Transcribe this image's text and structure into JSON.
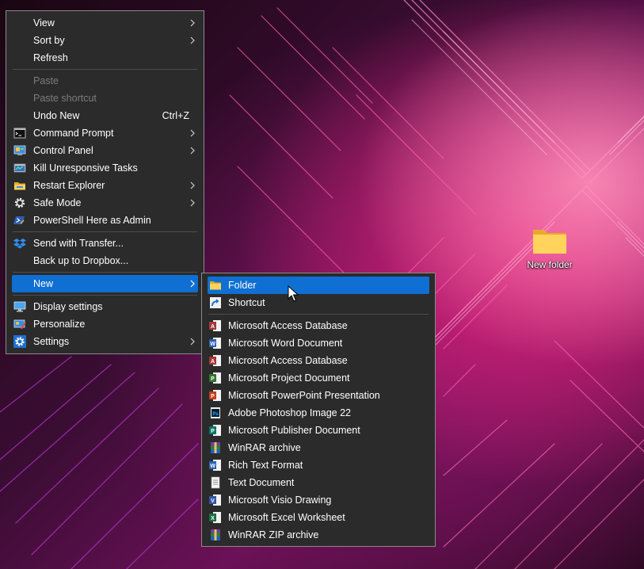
{
  "desktop": {
    "folder_label": "New folder"
  },
  "main_menu": {
    "items": [
      {
        "label": "View",
        "has_submenu": true
      },
      {
        "label": "Sort by",
        "has_submenu": true
      },
      {
        "label": "Refresh"
      },
      {
        "label": "Paste",
        "disabled": true
      },
      {
        "label": "Paste shortcut",
        "disabled": true
      },
      {
        "label": "Undo New",
        "shortcut": "Ctrl+Z"
      },
      {
        "label": "Command Prompt",
        "icon": "command-prompt-icon",
        "has_submenu": true
      },
      {
        "label": "Control Panel",
        "icon": "control-panel-icon",
        "has_submenu": true
      },
      {
        "label": "Kill Unresponsive Tasks",
        "icon": "kill-tasks-icon"
      },
      {
        "label": "Restart Explorer",
        "icon": "explorer-folder-icon",
        "has_submenu": true
      },
      {
        "label": "Safe Mode",
        "icon": "gear-icon",
        "has_submenu": true
      },
      {
        "label": "PowerShell Here as Admin",
        "icon": "powershell-icon"
      },
      {
        "label": "Send with Transfer...",
        "icon": "dropbox-icon"
      },
      {
        "label": "Back up to Dropbox..."
      },
      {
        "label": "New",
        "has_submenu": true,
        "highlighted": true
      },
      {
        "label": "Display settings",
        "icon": "display-icon"
      },
      {
        "label": "Personalize",
        "icon": "personalize-icon"
      },
      {
        "label": "Settings",
        "icon": "settings-gear-icon",
        "has_submenu": true
      }
    ]
  },
  "sub_menu": {
    "items": [
      {
        "label": "Folder",
        "icon": "folder-icon",
        "highlighted": true
      },
      {
        "label": "Shortcut",
        "icon": "shortcut-icon"
      },
      {
        "label": "Microsoft Access Database",
        "icon": "access-icon"
      },
      {
        "label": "Microsoft Word Document",
        "icon": "word-icon"
      },
      {
        "label": "Microsoft Access Database",
        "icon": "access-icon"
      },
      {
        "label": "Microsoft Project Document",
        "icon": "project-icon"
      },
      {
        "label": "Microsoft PowerPoint Presentation",
        "icon": "powerpoint-icon"
      },
      {
        "label": "Adobe Photoshop Image 22",
        "icon": "photoshop-icon"
      },
      {
        "label": "Microsoft Publisher Document",
        "icon": "publisher-icon"
      },
      {
        "label": "WinRAR archive",
        "icon": "winrar-icon"
      },
      {
        "label": "Rich Text Format",
        "icon": "rtf-icon"
      },
      {
        "label": "Text Document",
        "icon": "text-document-icon"
      },
      {
        "label": "Microsoft Visio Drawing",
        "icon": "visio-icon"
      },
      {
        "label": "Microsoft Excel Worksheet",
        "icon": "excel-icon"
      },
      {
        "label": "WinRAR ZIP archive",
        "icon": "winrar-zip-icon"
      }
    ]
  },
  "colors": {
    "menu_bg": "#2b2b2b",
    "highlight": "#0f6fd3",
    "disabled_text": "#7c7c7c"
  }
}
